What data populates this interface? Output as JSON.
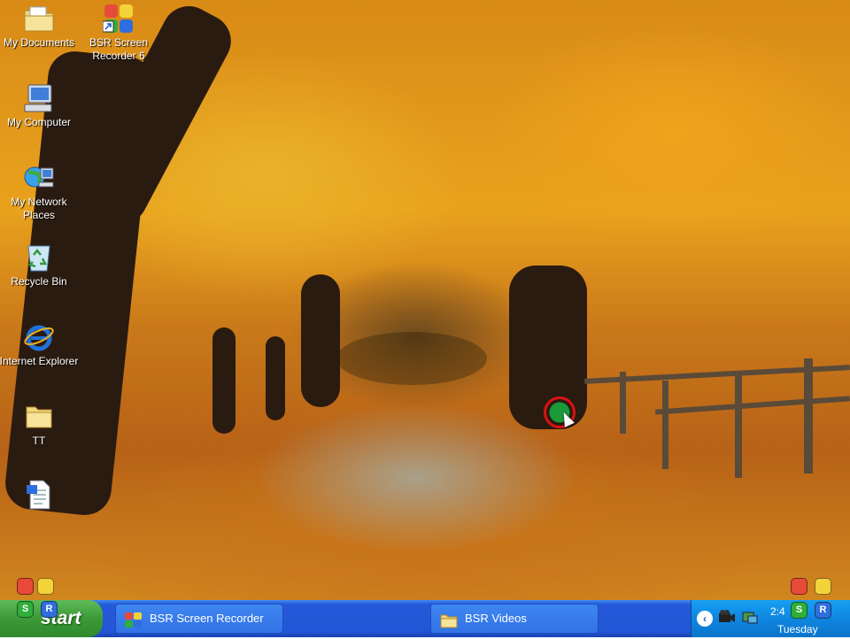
{
  "desktop": {
    "icons": [
      {
        "label": "My Documents",
        "icon": "folder-documents-icon"
      },
      {
        "label": "BSR Screen Recorder 6",
        "icon": "bsr-recorder-icon"
      },
      {
        "label": "My Computer",
        "icon": "computer-icon"
      },
      {
        "label": "My Network Places",
        "icon": "network-icon"
      },
      {
        "label": "Recycle Bin",
        "icon": "recycle-bin-icon"
      },
      {
        "label": "Internet Explorer",
        "icon": "internet-explorer-icon"
      },
      {
        "label": "TT",
        "icon": "folder-icon"
      },
      {
        "label": "",
        "icon": "document-icon"
      }
    ],
    "overlay_badge_letters": [
      "S",
      "R"
    ]
  },
  "taskbar": {
    "start_label": "start",
    "buttons": [
      {
        "label": "BSR Screen Recorder",
        "icon": "bsr-recorder-icon"
      },
      {
        "label": "BSR Videos",
        "icon": "folder-icon"
      }
    ],
    "clock": "2:4",
    "day": "Tuesday"
  },
  "colors": {
    "taskbar_blue": "#2356d6",
    "start_green": "#3b9a37",
    "tray_blue": "#0f86e0",
    "cursor_ring": "#dd1111"
  }
}
